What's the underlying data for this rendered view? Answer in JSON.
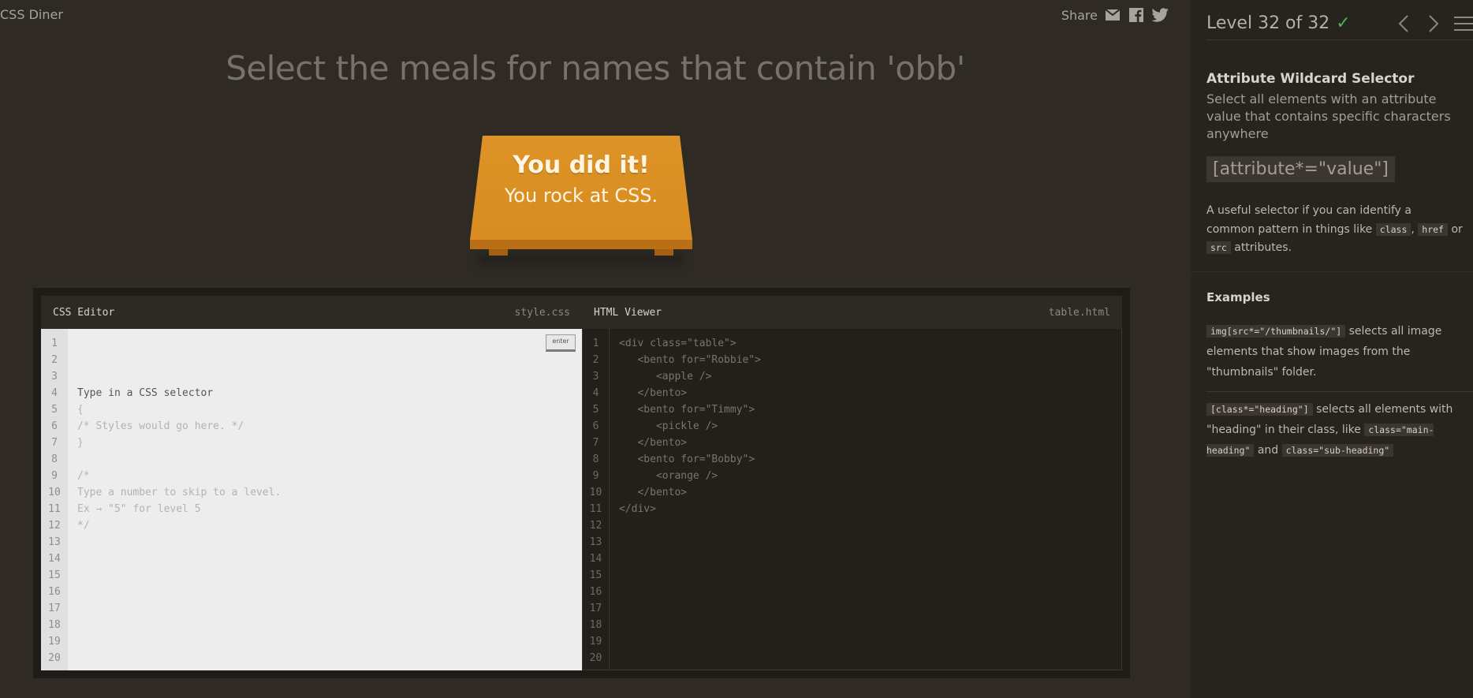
{
  "app": {
    "title": "CSS Diner"
  },
  "share": {
    "label": "Share",
    "icons": [
      "mail-icon",
      "facebook-icon",
      "twitter-icon"
    ]
  },
  "order": {
    "instruction": "Select the meals for names that contain 'obb'"
  },
  "win": {
    "line1": "You did it!",
    "line2": "You rock at CSS."
  },
  "css_editor": {
    "title": "CSS Editor",
    "file": "style.css",
    "enter_label": "enter",
    "line_numbers": [
      "1",
      "2",
      "3",
      "4",
      "5",
      "6",
      "7",
      "8",
      "9",
      "10",
      "11",
      "12",
      "13",
      "14",
      "15",
      "16",
      "17",
      "18",
      "19",
      "20"
    ],
    "lines": [
      "Type in a CSS selector",
      "{",
      "/* Styles would go here. */",
      "}",
      "",
      "/*",
      "Type a number to skip to a level.",
      "Ex → \"5\" for level 5",
      "*/"
    ]
  },
  "html_viewer": {
    "title": "HTML Viewer",
    "file": "table.html",
    "line_numbers": [
      "1",
      "2",
      "3",
      "4",
      "5",
      "6",
      "7",
      "8",
      "9",
      "10",
      "11",
      "12",
      "13",
      "14",
      "15",
      "16",
      "17",
      "18",
      "19",
      "20"
    ],
    "lines": [
      "<div class=\"table\">",
      "   <bento for=\"Robbie\">",
      "      <apple />",
      "   </bento>",
      "   <bento for=\"Timmy\">",
      "      <pickle />",
      "   </bento>",
      "   <bento for=\"Bobby\">",
      "      <orange />",
      "   </bento>",
      "</div>"
    ]
  },
  "sidebar": {
    "level_text": "Level 32 of 32",
    "completed": true,
    "selector_name": "Attribute Wildcard Selector",
    "title": "Select all elements with an attribute value that contains specific characters anywhere",
    "syntax": "[attribute*=\"value\"]",
    "hint": {
      "before": "A useful selector if you can identify a common pattern in things like",
      "code1": "class",
      "sep1": ",",
      "code2": "href",
      "sep2": "or",
      "code3": "src",
      "after": "attributes."
    },
    "examples_title": "Examples",
    "examples": [
      {
        "code": "img[src*=\"/thumbnails/\"]",
        "text": "selects all image elements that show images from the \"thumbnails\" folder."
      },
      {
        "code": "[class*=\"heading\"]",
        "text_before": "selects all elements with \"heading\" in their class, like",
        "code2": "class=\"main-heading\"",
        "mid": "and",
        "code3": "class=\"sub-heading\""
      }
    ]
  }
}
